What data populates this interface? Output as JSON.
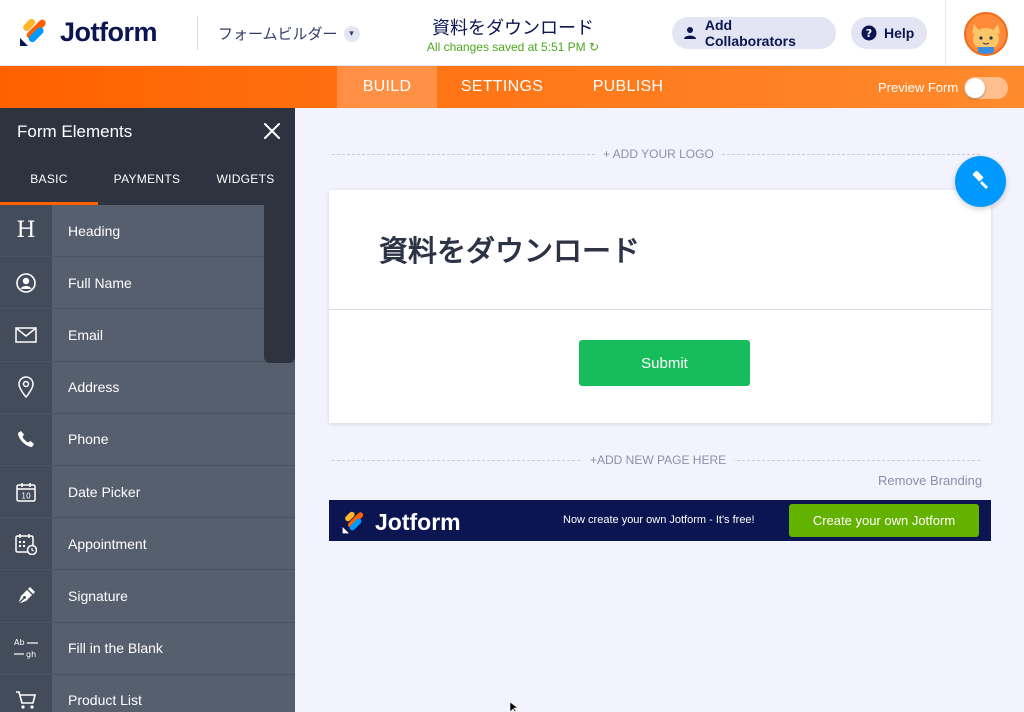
{
  "header": {
    "logo_text": "Jotform",
    "builder_label": "フォームビルダー",
    "form_title": "資料をダウンロード",
    "save_status": "All changes saved at 5:51 PM",
    "collab_label": "Add Collaborators",
    "help_label": "Help"
  },
  "nav": {
    "tabs": [
      {
        "label": "BUILD",
        "active": true
      },
      {
        "label": "SETTINGS",
        "active": false
      },
      {
        "label": "PUBLISH",
        "active": false
      }
    ],
    "preview_label": "Preview Form",
    "preview_on": false
  },
  "sidebar": {
    "title": "Form Elements",
    "tabs": [
      {
        "label": "BASIC",
        "active": true
      },
      {
        "label": "PAYMENTS",
        "active": false
      },
      {
        "label": "WIDGETS",
        "active": false
      }
    ],
    "items": [
      {
        "label": "Heading",
        "icon": "heading-icon"
      },
      {
        "label": "Full Name",
        "icon": "user-circle-icon"
      },
      {
        "label": "Email",
        "icon": "envelope-icon"
      },
      {
        "label": "Address",
        "icon": "map-pin-icon"
      },
      {
        "label": "Phone",
        "icon": "phone-icon"
      },
      {
        "label": "Date Picker",
        "icon": "calendar-icon"
      },
      {
        "label": "Appointment",
        "icon": "appointment-icon"
      },
      {
        "label": "Signature",
        "icon": "pen-icon"
      },
      {
        "label": "Fill in the Blank",
        "icon": "fill-blank-icon"
      },
      {
        "label": "Product List",
        "icon": "cart-icon"
      }
    ],
    "calendar_day": "10",
    "fill_blank_top": "Ab",
    "fill_blank_bottom": "gh"
  },
  "canvas": {
    "add_logo": "+ ADD YOUR LOGO",
    "heading": "資料をダウンロード",
    "submit_label": "Submit",
    "add_page": "+ADD NEW PAGE HERE",
    "remove_branding": "Remove Branding",
    "banner": {
      "logo_text": "Jotform",
      "text": "Now create your own Jotform - It's free!",
      "cta_label": "Create your own Jotform"
    }
  },
  "colors": {
    "brand_orange": "#ff6100",
    "brand_navy": "#0a1551",
    "submit_green": "#18bd5b",
    "cta_green": "#64b200",
    "save_green": "#4da91d",
    "designer_blue": "#0099ff"
  }
}
